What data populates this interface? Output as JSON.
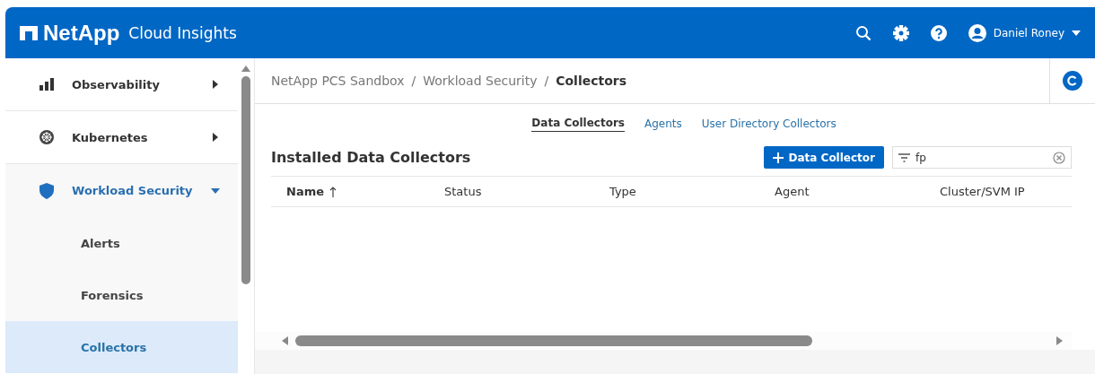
{
  "header": {
    "brand": "NetApp",
    "product": "Cloud Insights",
    "user": "Daniel Roney"
  },
  "sidebar": {
    "items": [
      {
        "label": "Observability",
        "expanded": false
      },
      {
        "label": "Kubernetes",
        "expanded": false
      },
      {
        "label": "Workload Security",
        "expanded": true,
        "children": [
          {
            "label": "Alerts",
            "selected": false
          },
          {
            "label": "Forensics",
            "selected": false
          },
          {
            "label": "Collectors",
            "selected": true
          }
        ]
      }
    ]
  },
  "breadcrumb": {
    "items": [
      "NetApp PCS Sandbox",
      "Workload Security",
      "Collectors"
    ],
    "separators": [
      "/",
      "/"
    ]
  },
  "tabs": [
    {
      "label": "Data Collectors",
      "selected": true
    },
    {
      "label": "Agents",
      "selected": false
    },
    {
      "label": "User Directory Collectors",
      "selected": false
    }
  ],
  "section_title": "Installed Data Collectors",
  "add_button": "Data Collector",
  "filter": {
    "value": "fp"
  },
  "table": {
    "columns": [
      {
        "label": "Name",
        "sorted": true
      },
      {
        "label": "Status",
        "sorted": false
      },
      {
        "label": "Type",
        "sorted": false
      },
      {
        "label": "Agent",
        "sorted": false
      },
      {
        "label": "Cluster/SVM IP",
        "sorted": false
      }
    ]
  }
}
